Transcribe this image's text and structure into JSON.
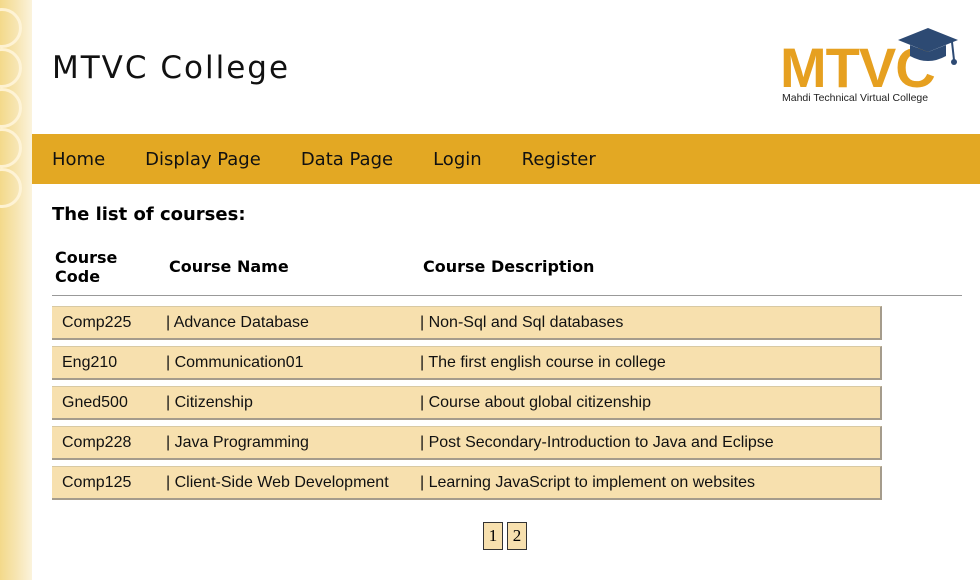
{
  "site": {
    "title": "MTVC College"
  },
  "logo": {
    "text": "MTVC",
    "subtitle": "Mahdi Technical Virtual College"
  },
  "nav": {
    "items": [
      {
        "label": "Home"
      },
      {
        "label": "Display Page"
      },
      {
        "label": "Data Page"
      },
      {
        "label": "Login"
      },
      {
        "label": "Register"
      }
    ]
  },
  "courses": {
    "title": "The list of courses:",
    "columns": {
      "code": "Course Code",
      "name": "Course Name",
      "description": "Course Description"
    },
    "rows": [
      {
        "code": "Comp225",
        "name": "| Advance Database",
        "description": "| Non-Sql and Sql databases"
      },
      {
        "code": "Eng210",
        "name": "| Communication01",
        "description": "| The first english course in college"
      },
      {
        "code": "Gned500",
        "name": "| Citizenship",
        "description": "| Course about global citizenship"
      },
      {
        "code": "Comp228",
        "name": "| Java Programming",
        "description": "| Post Secondary-Introduction to Java and Eclipse"
      },
      {
        "code": "Comp125",
        "name": "| Client-Side Web Development",
        "description": "| Learning JavaScript to implement on websites"
      }
    ]
  },
  "pagination": {
    "pages": [
      "1",
      "2"
    ]
  },
  "colors": {
    "brand": "#e3a823",
    "row_bg": "#f7e0ae",
    "logo_blue": "#2d4a73"
  }
}
